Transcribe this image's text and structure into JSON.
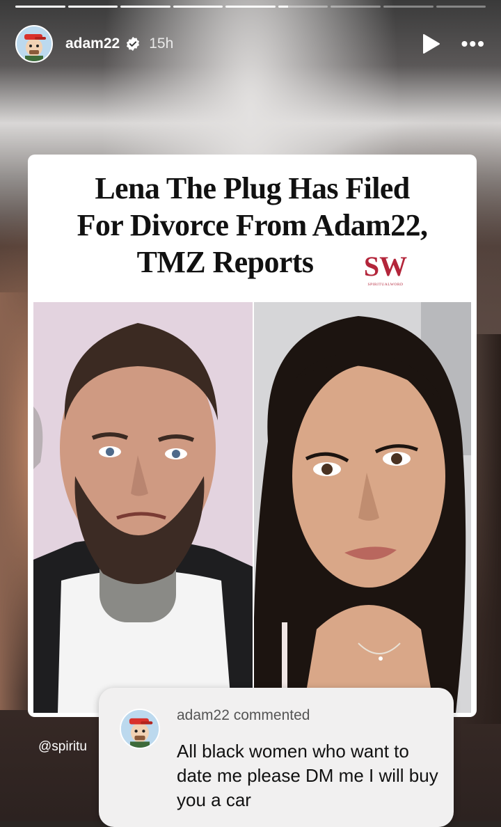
{
  "story": {
    "segments": 9,
    "progress": [
      1,
      1,
      1,
      1,
      1,
      0.2,
      0,
      0,
      0
    ]
  },
  "header": {
    "username": "adam22",
    "time_ago": "15h",
    "play_icon": "play-icon",
    "more_icon": "more-options-icon",
    "more_label": "•••"
  },
  "article": {
    "headline_lines": [
      "Lena The Plug Has Filed",
      "For Divorce From Adam22,",
      "TMZ Reports"
    ],
    "logo_text": "SPIRITUALWORD",
    "logo_monogram": "SW",
    "brand_color": "#b3253a"
  },
  "source_handle": "@spiritu",
  "comment": {
    "title": "adam22 commented",
    "text": "All black women who want to date me please DM me I will buy you a car"
  }
}
